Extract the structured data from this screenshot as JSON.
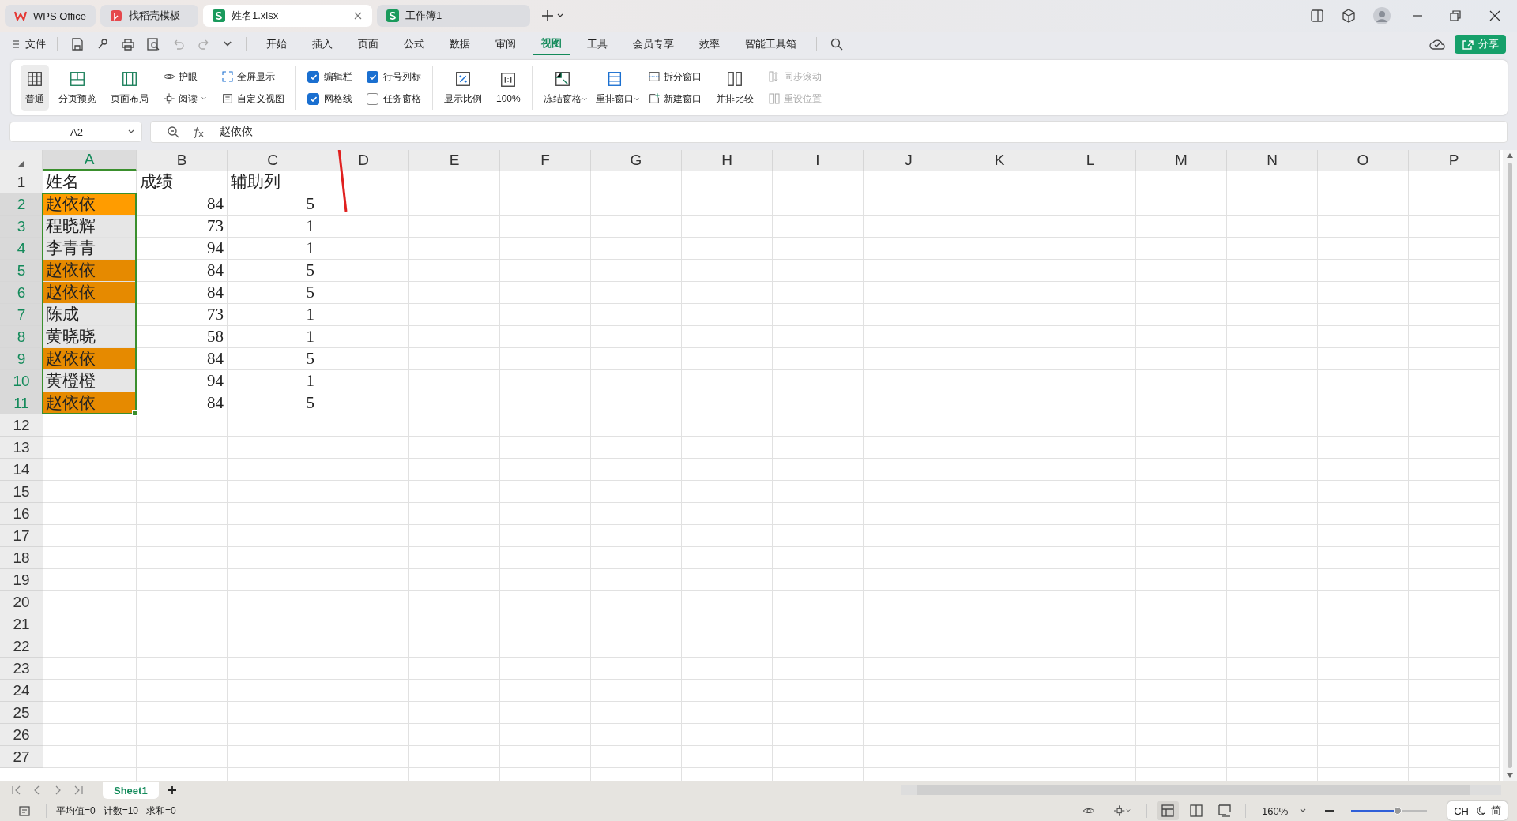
{
  "window": {
    "tabs": [
      {
        "label": "WPS Office",
        "kind": "home",
        "selected": false
      },
      {
        "label": "找稻壳模板",
        "kind": "template",
        "selected": false
      },
      {
        "label": "姓名1.xlsx",
        "kind": "sheet",
        "selected": true
      },
      {
        "label": "工作簿1",
        "kind": "sheet",
        "selected": false
      }
    ]
  },
  "menu": {
    "file": "文件",
    "tabs": [
      {
        "label": "开始",
        "selected": false
      },
      {
        "label": "插入",
        "selected": false
      },
      {
        "label": "页面",
        "selected": false
      },
      {
        "label": "公式",
        "selected": false
      },
      {
        "label": "数据",
        "selected": false
      },
      {
        "label": "审阅",
        "selected": false
      },
      {
        "label": "视图",
        "selected": true
      },
      {
        "label": "工具",
        "selected": false
      },
      {
        "label": "会员专享",
        "selected": false
      },
      {
        "label": "效率",
        "selected": false
      },
      {
        "label": "智能工具箱",
        "selected": false
      }
    ],
    "share": "分享"
  },
  "ribbon": {
    "groups": [
      {
        "items": [
          {
            "kind": "big",
            "label": "普通",
            "selected": true
          },
          {
            "kind": "big",
            "label": "分页预览",
            "selected": false
          },
          {
            "kind": "big",
            "label": "页面布局",
            "selected": false
          },
          {
            "kind": "stack",
            "items": [
              {
                "label": "护眼"
              },
              {
                "label": "阅读",
                "dropdown": true
              }
            ]
          },
          {
            "kind": "stack",
            "items": [
              {
                "label": "全屏显示"
              },
              {
                "label": "自定义视图"
              }
            ]
          }
        ]
      },
      {
        "items": [
          {
            "kind": "checks",
            "items": [
              {
                "label": "编辑栏",
                "checked": true
              },
              {
                "label": "网格线",
                "checked": true
              }
            ]
          },
          {
            "kind": "checks",
            "items": [
              {
                "label": "行号列标",
                "checked": true
              },
              {
                "label": "任务窗格",
                "checked": false
              }
            ]
          }
        ]
      },
      {
        "items": [
          {
            "kind": "big",
            "label": "显示比例",
            "selected": false
          },
          {
            "kind": "big",
            "label": "100%",
            "selected": false
          }
        ]
      },
      {
        "items": [
          {
            "kind": "big",
            "label": "冻结窗格",
            "selected": false,
            "dropdown": true
          },
          {
            "kind": "big",
            "label": "重排窗口",
            "selected": false,
            "dropdown": true
          },
          {
            "kind": "stack",
            "items": [
              {
                "label": "拆分窗口"
              },
              {
                "label": "新建窗口"
              }
            ]
          },
          {
            "kind": "big",
            "label": "并排比较",
            "selected": false
          },
          {
            "kind": "stack",
            "disabled": true,
            "items": [
              {
                "label": "同步滚动"
              },
              {
                "label": "重设位置"
              }
            ]
          }
        ]
      }
    ]
  },
  "formula_bar": {
    "name_box": "A2",
    "value": "赵依依"
  },
  "sheet": {
    "columns": [
      {
        "label": "A",
        "selected": true
      },
      {
        "label": "B",
        "selected": false
      },
      {
        "label": "C",
        "selected": false
      },
      {
        "label": "D",
        "selected": false
      },
      {
        "label": "E",
        "selected": false
      },
      {
        "label": "F",
        "selected": false
      },
      {
        "label": "G",
        "selected": false
      },
      {
        "label": "H",
        "selected": false
      },
      {
        "label": "I",
        "selected": false
      },
      {
        "label": "J",
        "selected": false
      },
      {
        "label": "K",
        "selected": false
      },
      {
        "label": "L",
        "selected": false
      },
      {
        "label": "M",
        "selected": false
      },
      {
        "label": "N",
        "selected": false
      },
      {
        "label": "O",
        "selected": false
      },
      {
        "label": "P",
        "selected": false
      }
    ],
    "rows": [
      {
        "number": "1",
        "kind": "header",
        "cells": [
          "姓名",
          "成绩",
          "辅助列"
        ],
        "selected": false
      },
      {
        "number": "2",
        "kind": "data",
        "cells": [
          "赵依依",
          "84",
          "5"
        ],
        "selected": true,
        "active": true,
        "highlighted": true
      },
      {
        "number": "3",
        "kind": "data",
        "cells": [
          "程晓辉",
          "73",
          "1"
        ],
        "selected": true,
        "active": false,
        "highlighted": false
      },
      {
        "number": "4",
        "kind": "data",
        "cells": [
          "李青青",
          "94",
          "1"
        ],
        "selected": true,
        "active": false,
        "highlighted": false
      },
      {
        "number": "5",
        "kind": "data",
        "cells": [
          "赵依依",
          "84",
          "5"
        ],
        "selected": true,
        "active": false,
        "highlighted": true
      },
      {
        "number": "6",
        "kind": "data",
        "cells": [
          "赵依依",
          "84",
          "5"
        ],
        "selected": true,
        "active": false,
        "highlighted": true
      },
      {
        "number": "7",
        "kind": "data",
        "cells": [
          "陈成",
          "73",
          "1"
        ],
        "selected": true,
        "active": false,
        "highlighted": false
      },
      {
        "number": "8",
        "kind": "data",
        "cells": [
          "黄晓晓",
          "58",
          "1"
        ],
        "selected": true,
        "active": false,
        "highlighted": false
      },
      {
        "number": "9",
        "kind": "data",
        "cells": [
          "赵依依",
          "84",
          "5"
        ],
        "selected": true,
        "active": false,
        "highlighted": true
      },
      {
        "number": "10",
        "kind": "data",
        "cells": [
          "黄橙橙",
          "94",
          "1"
        ],
        "selected": true,
        "active": false,
        "highlighted": false
      },
      {
        "number": "11",
        "kind": "data",
        "cells": [
          "赵依依",
          "84",
          "5"
        ],
        "selected": true,
        "active": false,
        "highlighted": true
      },
      {
        "number": "12"
      },
      {
        "number": "13"
      },
      {
        "number": "14"
      },
      {
        "number": "15"
      },
      {
        "number": "16"
      },
      {
        "number": "17"
      },
      {
        "number": "18"
      },
      {
        "number": "19"
      },
      {
        "number": "20"
      },
      {
        "number": "21"
      },
      {
        "number": "22"
      },
      {
        "number": "23"
      },
      {
        "number": "24"
      },
      {
        "number": "25"
      },
      {
        "number": "26"
      },
      {
        "number": "27"
      }
    ],
    "sheet_tabs": [
      {
        "label": "Sheet1",
        "selected": true
      }
    ]
  },
  "status_bar": {
    "stats": [
      "平均值=0",
      "计数=10",
      "求和=0"
    ],
    "views": [
      {
        "kind": "normal",
        "selected": true
      },
      {
        "kind": "pagebreak",
        "selected": false
      },
      {
        "kind": "layout",
        "selected": false
      }
    ],
    "zoom": "160%",
    "zoom_slider": {
      "level": 0.6
    },
    "ime": [
      "CH",
      "简"
    ]
  }
}
